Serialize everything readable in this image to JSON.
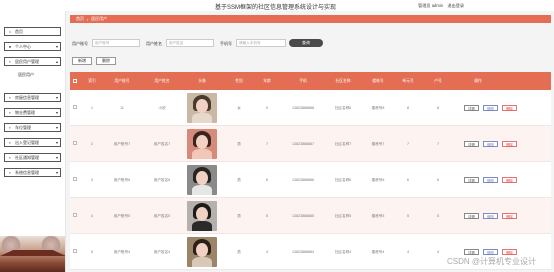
{
  "header": {
    "title": "基于SSM框架的社区信息管理系统设计与实现",
    "role_label": "管理员 admin",
    "logout_label": "退出登录"
  },
  "sidebar": {
    "items": [
      {
        "label": "首页",
        "icon": "home-icon"
      },
      {
        "label": "个人中心",
        "icon": "user-icon"
      },
      {
        "label": "居民用户管理",
        "icon": "users-icon"
      },
      {
        "label": "房屋信息管理",
        "icon": "house-icon"
      },
      {
        "label": "物业费管理",
        "icon": "money-icon"
      },
      {
        "label": "车位管理",
        "icon": "car-icon"
      },
      {
        "label": "出入登记管理",
        "icon": "entry-icon"
      },
      {
        "label": "社区通知管理",
        "icon": "notice-icon"
      },
      {
        "label": "系统信息管理",
        "icon": "system-icon"
      }
    ],
    "sub_item": "居民用户"
  },
  "breadcrumb": {
    "home": "首页",
    "current": "居民用户"
  },
  "filters": {
    "account_label": "用户账号",
    "account_placeholder": "用户账号",
    "name_label": "用户姓名",
    "name_placeholder": "用户姓名",
    "phone_label": "手机号",
    "phone_placeholder": "请输入手机号",
    "search_label": "查询"
  },
  "actions": {
    "add": "新增",
    "delete": "删除"
  },
  "table": {
    "headers": [
      "索引",
      "用户账号",
      "用户姓名",
      "头像",
      "性别",
      "年龄",
      "手机",
      "社区名称",
      "楼栋号",
      "单元号",
      "户号",
      "操作"
    ],
    "rows": [
      {
        "index": "1",
        "account": "11",
        "name": "小欣",
        "gender": "女",
        "age": "0",
        "phone": "13823888888",
        "community": "社区名称8",
        "building": "楼栋号8",
        "unit": "8",
        "room": "8"
      },
      {
        "index": "2",
        "account": "用户账号7",
        "name": "用户姓名7",
        "gender": "男",
        "age": "7",
        "phone": "13823888887",
        "community": "社区名称7",
        "building": "楼栋号7",
        "unit": "7",
        "room": "7"
      },
      {
        "index": "3",
        "account": "用户账号6",
        "name": "用户姓名6",
        "gender": "男",
        "age": "6",
        "phone": "13823888886",
        "community": "社区名称6",
        "building": "楼栋号6",
        "unit": "6",
        "room": "6"
      },
      {
        "index": "4",
        "account": "用户账号5",
        "name": "用户姓名5",
        "gender": "男",
        "age": "5",
        "phone": "13823888885",
        "community": "社区名称5",
        "building": "楼栋号5",
        "unit": "5",
        "room": "5"
      },
      {
        "index": "5",
        "account": "用户账号4",
        "name": "用户姓名4",
        "gender": "男",
        "age": "4",
        "phone": "13823888884",
        "community": "社区名称4",
        "building": "楼栋号4",
        "unit": "4",
        "room": "4"
      }
    ],
    "row_actions": {
      "detail": "详情",
      "edit": "修改",
      "delete": "删除"
    }
  },
  "watermark": "CSDN @计算机专业设计"
}
